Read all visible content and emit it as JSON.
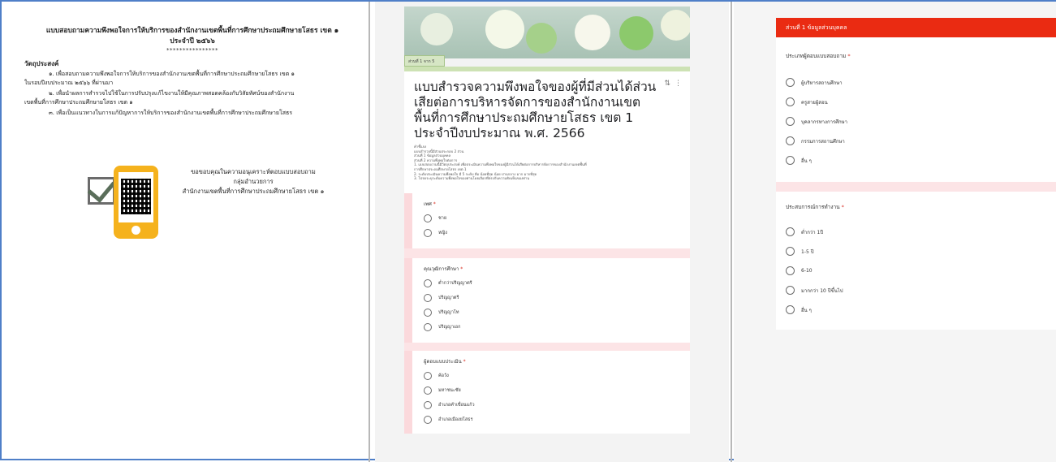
{
  "letter": {
    "title_line1": "แบบสอบถามความพึงพอใจการให้บริการของสำนักงานเขตพื้นที่การศึกษาประถมศึกษายโสธร เขต ๑",
    "title_line2": "ประจำปี ๒๕๖๖",
    "stars": "****************",
    "objective_heading": "วัตถุประสงค์",
    "objective1_a": "๑. เพื่อสอบถามความพึงพอใจการให้บริการของสำนักงานเขตพื้นที่การศึกษาประถมศึกษายโสธร เขต ๑",
    "objective1_b": "ในรอบปีงบประมาณ ๒๕๖๖ ที่ผ่านมา",
    "objective2_a": "๒. เพื่อนำผลการสำรวจไปใช้ในการปรับปรุงแก้ไขงานให้มีคุณภาพสอดคล้องกับวิสัยทัศน์ของสำนักงาน",
    "objective2_b": "เขตพื้นที่การศึกษาประถมศึกษายโสธร เขต ๑",
    "objective3": "๓. เพื่อเป็นแนวทางในการแก้ปัญหาการให้บริการของสำนักงานเขตพื้นที่การศึกษาประถมศึกษายโสธร",
    "thanks_line1": "ขอขอบคุณในความอนุเคราะห์ตอบแบบสอบถาม",
    "thanks_line2": "กลุ่มอำนวยการ",
    "thanks_line3": "สำนักงานเขตพื้นที่การศึกษาประถมศึกษายโสธร เขต ๑"
  },
  "form": {
    "section_tab": "ส่วนที่ 1 จาก 5",
    "title": "แบบสำรวจความพึงพอใจของผู้ที่มีส่วนได้ส่วนเสียต่อการบริหารจัดการของสำนักงานเขตพื้นที่การศึกษาประถมศึกษายโสธร เขต 1 ประจำปีงบประมาณ พ.ศ. 2566",
    "desc": [
      "คำชี้แจง",
      "แบบสำรวจนี้มีส่วนประกอบ 2 ส่วน",
      "ส่วนที่ 1 ข้อมูลส่วนบุคคล",
      "ส่วนที่ 2 ความพึงพอใจต่อการ",
      "1. แบบสอบถามนี้มีวัตถุประสงค์ เพื่อประเมินความพึงพอใจของผู้มีส่วนได้เสียต่อการบริหารจัดการของสำนักงานเขตพื้นที่",
      "การศึกษาประถมศึกษายโสธร เขต 1",
      "2. ระดับประเมินความพึงพอใจ มี 5 ระดับ คือ น้อยที่สุด น้อย ปานกลาง มาก มากที่สุด",
      "3. โปรดระบุระดับความพึงพอใจของท่านโดยเลือกที่ตรงกับความคิดเห็นของท่าน"
    ],
    "q1": {
      "label": "เพศ",
      "options": [
        "ชาย",
        "หญิง"
      ]
    },
    "q2": {
      "label": "คุณวุฒิการศึกษา",
      "options": [
        "ต่ำกว่าปริญญาตรี",
        "ปริญญาตรี",
        "ปริญญาโท",
        "ปริญญาเอก"
      ]
    },
    "q3": {
      "label": "ผู้ตอบแบบประเมิน",
      "options": [
        "ค้อวัง",
        "มหาชนะชัย",
        "อำเภอคำเขื่อนแก้ว",
        "อำเภอเมืองยโสธร"
      ]
    },
    "required": "*"
  },
  "section1": {
    "header": "ส่วนที่ 1 ข้อมูลส่วนบุคคล",
    "q1": {
      "label": "ประเภทผู้ตอบแบบสอบถาม",
      "options": [
        "ผู้บริหารสถานศึกษา",
        "ครูสายผู้สอน",
        "บุคลากรทางการศึกษา",
        "กรรมการสถานศึกษา",
        "อื่น ๆ"
      ]
    },
    "q2": {
      "label": "ประสบการณ์การทำงาน",
      "options": [
        "ต่ำกว่า 1ปี",
        "1-5 ปี",
        "6-10",
        "มากกว่า 10 ปีขึ้นไป",
        "อื่น ๆ"
      ]
    },
    "required": "*"
  },
  "colors": {
    "frame": "#4f7fc8",
    "header_red": "#ea2b12",
    "phone_yellow": "#f5b21d",
    "pink": "#fce4e6"
  }
}
